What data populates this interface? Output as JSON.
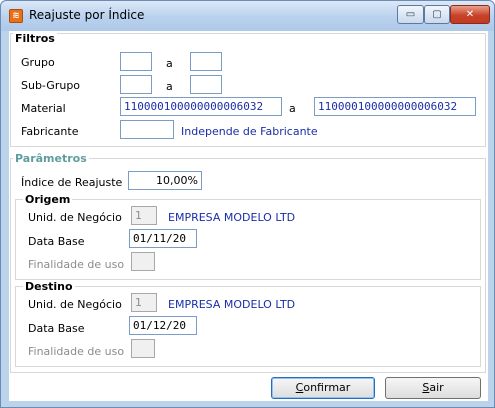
{
  "window": {
    "title": "Reajuste por Índice",
    "icon": "app-icon",
    "controls": {
      "minimize": "▭",
      "maximize": "▢",
      "close": "✕"
    }
  },
  "filtros": {
    "title": "Filtros",
    "sep": "a",
    "grupo": {
      "label": "Grupo",
      "from": "",
      "to": ""
    },
    "subgrupo": {
      "label": "Sub-Grupo",
      "from": "",
      "to": ""
    },
    "material": {
      "label": "Material",
      "from": "110000100000000006032",
      "to": "110000100000000006032"
    },
    "fabricante": {
      "label": "Fabricante",
      "value": "",
      "note": "Independe de Fabricante"
    }
  },
  "parametros": {
    "title": "Parâmetros",
    "indice": {
      "label": "Índice de Reajuste",
      "value": "10,00%"
    },
    "origem": {
      "title": "Origem",
      "unid_label": "Unid. de Negócio",
      "unid_value": "1",
      "empresa": "EMPRESA MODELO LTD",
      "data_label": "Data Base",
      "data_value": "01/11/20",
      "finalidade_label": "Finalidade de uso",
      "finalidade_value": ""
    },
    "destino": {
      "title": "Destino",
      "unid_label": "Unid. de Negócio",
      "unid_value": "1",
      "empresa": "EMPRESA MODELO LTD",
      "data_label": "Data Base",
      "data_value": "01/12/20",
      "finalidade_label": "Finalidade de uso",
      "finalidade_value": ""
    }
  },
  "buttons": {
    "confirmar_first": "C",
    "confirmar_rest": "onfirmar",
    "sair_first": "S",
    "sair_rest": "air"
  }
}
